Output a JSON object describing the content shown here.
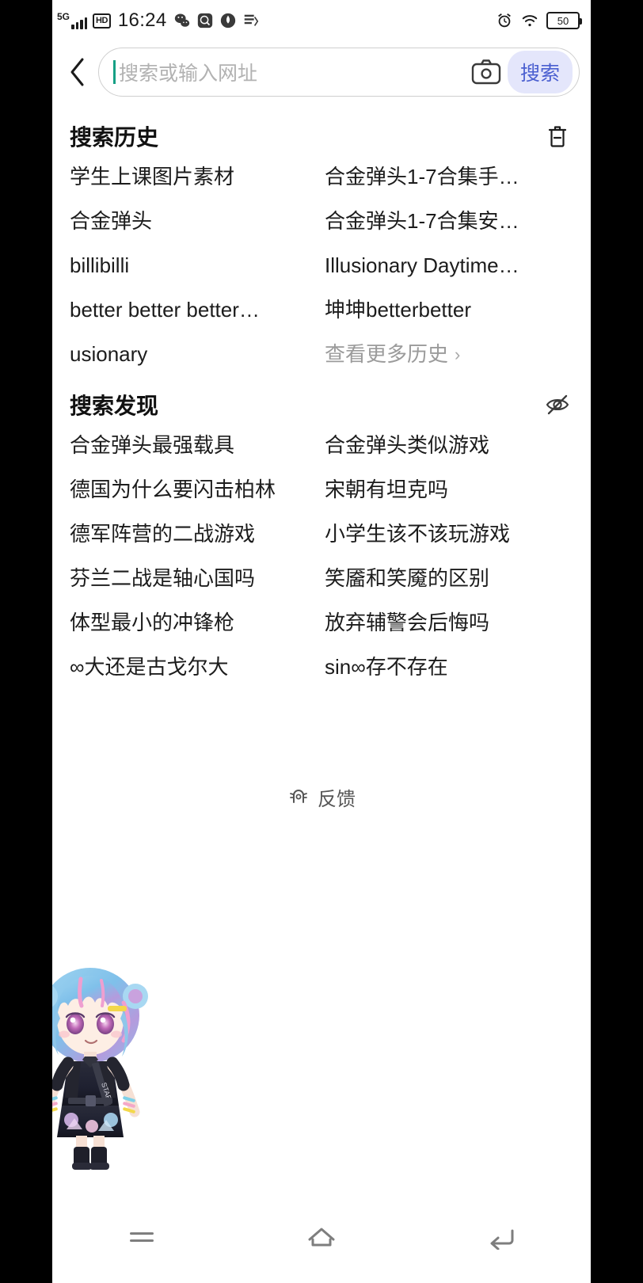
{
  "statusbar": {
    "network_label": "5G",
    "hd_label": "HD",
    "time": "16:24",
    "battery_level": "50",
    "icons_left": [
      "signal-bars-icon",
      "hd-icon",
      "wechat-icon",
      "baidu-icon",
      "alipay-icon",
      "app-icon"
    ],
    "icons_right": [
      "alarm-icon",
      "wifi-icon",
      "battery-icon"
    ]
  },
  "searchbar": {
    "back_icon": "chevron-left-icon",
    "placeholder": "搜索或输入网址",
    "value": "",
    "camera_icon": "camera-icon",
    "search_label": "搜索",
    "accent_bg": "#e4e6fb",
    "accent_fg": "#4a5fd0",
    "caret_color": "#16a085"
  },
  "history": {
    "title": "搜索历史",
    "clear_icon": "trash-icon",
    "items": [
      "学生上课图片素材",
      "合金弹头1-7合集手…",
      "合金弹头",
      "合金弹头1-7合集安…",
      "billibilli",
      "Illusionary Daytime…",
      "better better better…",
      "坤坤betterbetter",
      "usionary"
    ],
    "more_label": "查看更多历史",
    "more_chevron": "›"
  },
  "discover": {
    "title": "搜索发现",
    "hide_icon": "eye-off-icon",
    "items": [
      "合金弹头最强载具",
      "合金弹头类似游戏",
      "德国为什么要闪击柏林",
      "宋朝有坦克吗",
      "德军阵营的二战游戏",
      "小学生该不该玩游戏",
      "芬兰二战是轴心国吗",
      "笑靥和笑魇的区别",
      "体型最小的冲锋枪",
      "放弃辅警会后悔吗",
      "∞大还是古戈尔大",
      "sin∞存不存在"
    ]
  },
  "feedback": {
    "icon": "feedback-icon",
    "label": "反馈"
  },
  "navbar": {
    "menu_icon": "menu-icon",
    "home_icon": "home-icon",
    "back_icon": "back-arrow-icon"
  },
  "mascot": {
    "name": "chibi-avatar"
  }
}
